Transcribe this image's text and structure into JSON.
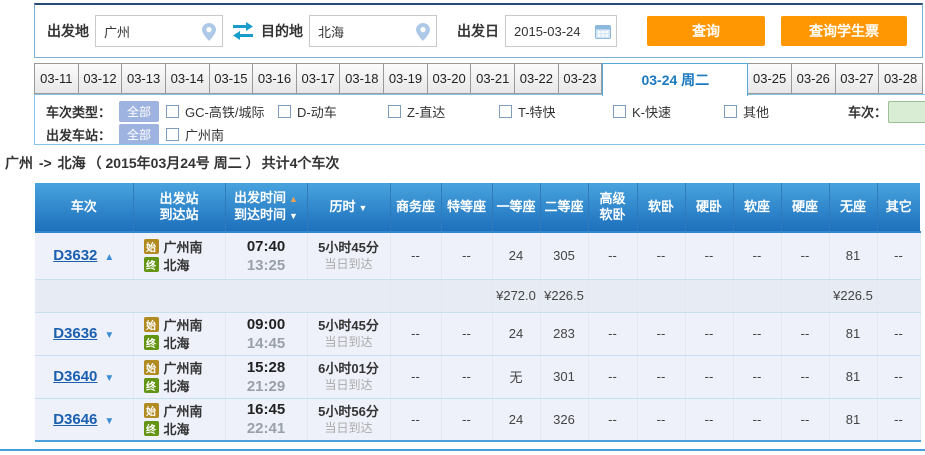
{
  "search_bar": {
    "from_label": "出发地",
    "from_value": "广州",
    "to_label": "目的地",
    "to_value": "北海",
    "date_label": "出发日",
    "date_value": "2015-03-24",
    "search_button": "查询",
    "student_button": "查询学生票",
    "accent_color": "#ff9702"
  },
  "date_tabs": {
    "before": [
      "03-11",
      "03-12",
      "03-13",
      "03-14",
      "03-15",
      "03-16",
      "03-17",
      "03-18",
      "03-19",
      "03-20",
      "03-21",
      "03-22",
      "03-23"
    ],
    "selected": "03-24 周二",
    "after": [
      "03-25",
      "03-26",
      "03-27",
      "03-28"
    ]
  },
  "filters": {
    "type_label": "车次类型：",
    "type_all": "全部",
    "type_options": [
      "GC-高铁/城际",
      "D-动车",
      "Z-直达",
      "T-特快",
      "K-快速",
      "其他"
    ],
    "train_no_label": "车次：",
    "station_label": "出发车站：",
    "station_all": "全部",
    "station_options": [
      "广州南"
    ]
  },
  "summary": {
    "from": "广州",
    "arrow": "->",
    "to": "北海",
    "detail": "（ 2015年03月24号  周二 ）",
    "count": "共计4个车次"
  },
  "table": {
    "badge_start": "始",
    "badge_end": "终",
    "headers": [
      {
        "lines": [
          "车次"
        ]
      },
      {
        "lines": [
          "出发站",
          "到达站"
        ]
      },
      {
        "lines": [
          "出发时间",
          "到达时间"
        ],
        "arrows": [
          "up-active",
          "down"
        ]
      },
      {
        "lines": [
          "历时"
        ],
        "arrows": [
          "down"
        ]
      },
      {
        "lines": [
          "商务座"
        ]
      },
      {
        "lines": [
          "特等座"
        ]
      },
      {
        "lines": [
          "一等座"
        ]
      },
      {
        "lines": [
          "二等座"
        ]
      },
      {
        "lines": [
          "高级",
          "软卧"
        ]
      },
      {
        "lines": [
          "软卧"
        ]
      },
      {
        "lines": [
          "硬卧"
        ]
      },
      {
        "lines": [
          "软座"
        ]
      },
      {
        "lines": [
          "硬座"
        ]
      },
      {
        "lines": [
          "无座"
        ]
      },
      {
        "lines": [
          "其它"
        ]
      }
    ],
    "rows": [
      {
        "type": "train",
        "train": "D3632",
        "caret": "up",
        "from": "广州南",
        "to": "北海",
        "dep": "07:40",
        "arr": "13:25",
        "duration": "5小时45分",
        "note": "当日到达",
        "seats": [
          "--",
          "--",
          "24",
          "305",
          "--",
          "--",
          "--",
          "--",
          "--",
          "81",
          "--"
        ]
      },
      {
        "type": "price",
        "cells": [
          "",
          "",
          "¥272.0",
          "¥226.5",
          "",
          "",
          "",
          "",
          "",
          "¥226.5",
          ""
        ]
      },
      {
        "type": "train",
        "train": "D3636",
        "caret": "down",
        "from": "广州南",
        "to": "北海",
        "dep": "09:00",
        "arr": "14:45",
        "duration": "5小时45分",
        "note": "当日到达",
        "seats": [
          "--",
          "--",
          "24",
          "283",
          "--",
          "--",
          "--",
          "--",
          "--",
          "81",
          "--"
        ]
      },
      {
        "type": "train",
        "train": "D3640",
        "caret": "down",
        "from": "广州南",
        "to": "北海",
        "dep": "15:28",
        "arr": "21:29",
        "duration": "6小时01分",
        "note": "当日到达",
        "seats": [
          "--",
          "--",
          "无",
          "301",
          "--",
          "--",
          "--",
          "--",
          "--",
          "81",
          "--"
        ]
      },
      {
        "type": "train",
        "train": "D3646",
        "caret": "down",
        "from": "广州南",
        "to": "北海",
        "dep": "16:45",
        "arr": "22:41",
        "duration": "5小时56分",
        "note": "当日到达",
        "seats": [
          "--",
          "--",
          "24",
          "326",
          "--",
          "--",
          "--",
          "--",
          "--",
          "81",
          "--"
        ]
      }
    ]
  }
}
